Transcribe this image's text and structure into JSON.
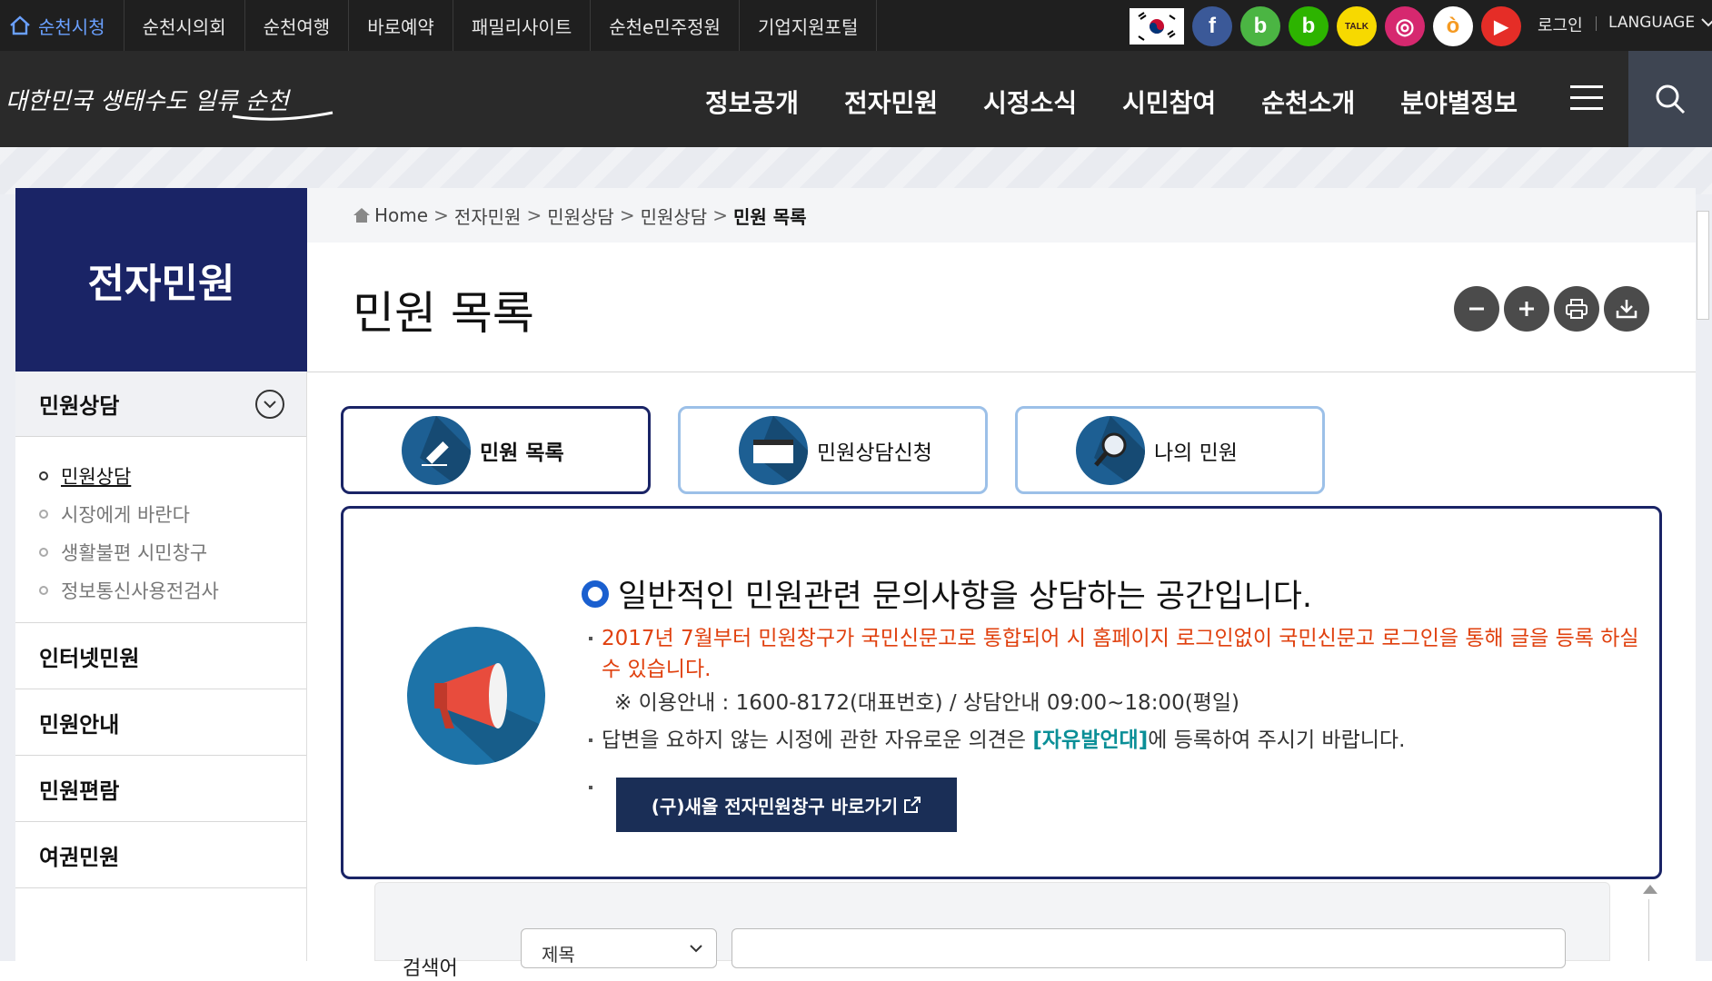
{
  "topbar": {
    "links": [
      "순천시청",
      "순천시의회",
      "순천여행",
      "바로예약",
      "패밀리사이트",
      "순천e민주정원",
      "기업지원포털"
    ],
    "social": [
      {
        "name": "facebook",
        "glyph": "f",
        "color": "#3b5998"
      },
      {
        "name": "band",
        "glyph": "b",
        "color": "#4bb543"
      },
      {
        "name": "blog",
        "glyph": "b",
        "color": "#2db400"
      },
      {
        "name": "kakaotalk",
        "glyph": "TALK",
        "color": "#f7d900"
      },
      {
        "name": "instagram",
        "glyph": "◎",
        "color": "#d6286f"
      },
      {
        "name": "kakaostory",
        "glyph": "ò",
        "color": "#f59a22"
      },
      {
        "name": "youtube",
        "glyph": "▶",
        "color": "#e52d27"
      }
    ],
    "login": "로그인",
    "language": "LANGUAGE"
  },
  "header": {
    "logo_text": "대한민국 생태수도 일류 순천",
    "gnb": [
      "정보공개",
      "전자민원",
      "시정소식",
      "시민참여",
      "순천소개",
      "분야별정보"
    ]
  },
  "lnb": {
    "title": "전자민원",
    "current_group": "민원상담",
    "sub_items": [
      {
        "label": "민원상담",
        "active": true
      },
      {
        "label": "시장에게 바란다",
        "active": false
      },
      {
        "label": "생활불편 시민창구",
        "active": false
      },
      {
        "label": "정보통신사용전검사",
        "active": false
      }
    ],
    "menus": [
      "인터넷민원",
      "민원안내",
      "민원편람",
      "여권민원"
    ]
  },
  "breadcrumb": {
    "items": [
      "Home",
      "전자민원",
      "민원상담",
      "민원상담"
    ],
    "current": "민원 목록"
  },
  "page": {
    "title": "민원 목록",
    "tools": [
      "zoom-out",
      "zoom-in",
      "print",
      "download"
    ]
  },
  "tabs": [
    {
      "label": "민원 목록",
      "active": true
    },
    {
      "label": "민원상담신청",
      "active": false
    },
    {
      "label": "나의 민원",
      "active": false
    }
  ],
  "info": {
    "heading": "일반적인 민원관련 문의사항을 상담하는 공간입니다.",
    "notice": "2017년 7월부터 민원창구가 국민신문고로 통합되어 시 홈페이지 로그인없이 국민신문고 로그인을 통해 글을 등록 하실 수 있습니다.",
    "contact": "※ 이용안내 : 1600-8172(대표번호) / 상담안내 09:00~18:00(평일)",
    "free_pre": "답변을 요하지 않는 시정에 관한 자유로운 의견은 ",
    "free_link": "[자유발언대]",
    "free_post": "에 등록하여 주시기 바랍니다.",
    "button": "(구)새올 전자민원창구 바로가기"
  },
  "search": {
    "label": "검색어",
    "select_value": "제목",
    "input_value": ""
  },
  "colors": {
    "nav_navy": "#1a2466",
    "notice_red": "#e0400e",
    "link_teal": "#0a8f97",
    "tab_border": "#9cc0e8"
  }
}
